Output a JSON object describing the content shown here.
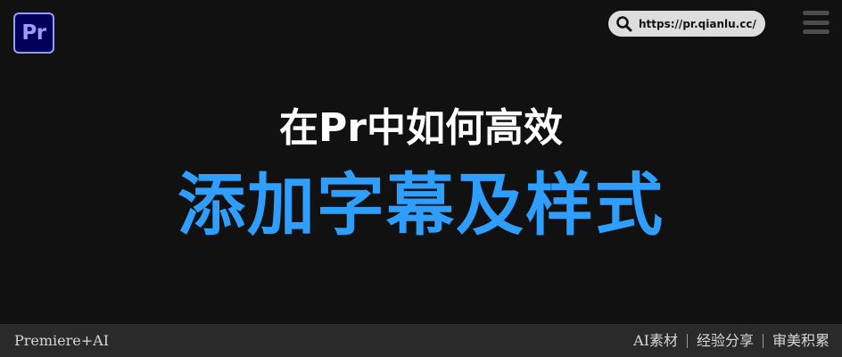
{
  "app": {
    "logo_text": "Pr"
  },
  "header": {
    "url": "https://pr.qianlu.cc/"
  },
  "main": {
    "headline": "在Pr中如何高效",
    "title": "添加字幕及样式"
  },
  "footer": {
    "left": "Premiere+AI",
    "tags": [
      "AI素材",
      "经验分享",
      "审美积累"
    ]
  },
  "colors": {
    "background": "#111111",
    "title_accent": "#2e9fff",
    "logo_bg": "#00005b",
    "logo_fg": "#9a9bff",
    "footer_bg": "#2a2a2a"
  },
  "icons": {
    "search": "search-icon",
    "menu": "hamburger-menu-icon"
  }
}
